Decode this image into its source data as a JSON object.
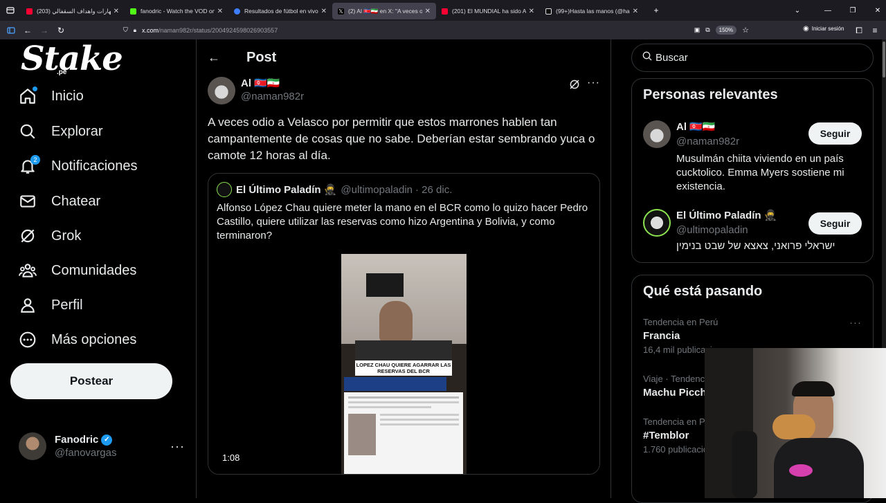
{
  "browser": {
    "tabs": [
      {
        "title": "(203) مهارات واهداف السقفالي",
        "color": "#ff0033"
      },
      {
        "title": "fanodric - Watch the VOD on Kick",
        "color": "#53fc18"
      },
      {
        "title": "Resultados de fútbol en vivo, M",
        "color": "#3d7fff"
      },
      {
        "title": "(2) Al 🇰🇵🇮🇷 en X: \"A veces odio a",
        "color": "#ffffff",
        "active": true
      },
      {
        "title": "(201) El MUNDIAL ha sido ARRU",
        "color": "#ff0033"
      },
      {
        "title": "(99+)Hasta las manos (@hasta_",
        "color": "#ffffff"
      }
    ],
    "url_host": "x.com",
    "url_path": "/naman982r/status/2004924598026903557",
    "zoom": "150%",
    "signin": "Iniciar sesión"
  },
  "sidebar": {
    "logo": "Stake",
    "logo_sub": ".pe",
    "items": [
      {
        "label": "Inicio",
        "icon": "home-icon"
      },
      {
        "label": "Explorar",
        "icon": "search-icon"
      },
      {
        "label": "Notificaciones",
        "icon": "bell-icon",
        "badge": "2"
      },
      {
        "label": "Chatear",
        "icon": "mail-icon"
      },
      {
        "label": "Grok",
        "icon": "grok-icon"
      },
      {
        "label": "Comunidades",
        "icon": "communities-icon"
      },
      {
        "label": "Perfil",
        "icon": "profile-icon"
      },
      {
        "label": "Más opciones",
        "icon": "more-circle-icon"
      }
    ],
    "post_button": "Postear",
    "me": {
      "name": "Fanodric",
      "handle": "@fanovargas"
    }
  },
  "main": {
    "header_title": "Post",
    "tweet": {
      "name": "Al 🇰🇵🇮🇷",
      "handle": "@naman982r",
      "text": "A veces odio a Velasco por permitir que estos marrones hablen tan campantemente de cosas que no sabe. Deberían estar sembrando yuca o camote 12 horas al día."
    },
    "quote": {
      "name": "El Último Paladín 🥷",
      "handle": "@ultimopaladin",
      "date": "· 26 dic.",
      "text": "Alfonso López Chau quiere meter la mano en el BCR como lo quizo hacer Pedro Castillo, quiere utilizar las reservas como hizo Argentina y Bolivia, y como terminaron?",
      "video_caption": "LOPEZ CHAU QUIERE AGARRAR LAS RESERVAS DEL BCR",
      "duration": "1:08"
    }
  },
  "right": {
    "search_placeholder": "Buscar",
    "relevant_title": "Personas relevantes",
    "people": [
      {
        "name": "Al 🇰🇵🇮🇷",
        "handle": "@naman982r",
        "bio": "Musulmán chiita viviendo en un país cucktolico. Emma Myers sostiene mi existencia.",
        "button": "Seguir"
      },
      {
        "name": "El Último Paladín 🥷",
        "handle": "@ultimopaladin",
        "bio": "ישראלי פרואני, צאצא של שבט בנימין",
        "button": "Seguir"
      }
    ],
    "trends_title": "Qué está pasando",
    "trends": [
      {
        "context": "Tendencia en Perú",
        "name": "Francia",
        "count": "16,4 mil publicaciones"
      },
      {
        "context": "Viaje · Tendencia",
        "name": "Machu Picchu",
        "count": ""
      },
      {
        "context": "Tendencia en Perú",
        "name": "#Temblor",
        "count": "1.760 publicaciones"
      }
    ]
  },
  "colors": {
    "accent": "#1d9bf0",
    "border": "#2f3336",
    "muted": "#71767b"
  }
}
